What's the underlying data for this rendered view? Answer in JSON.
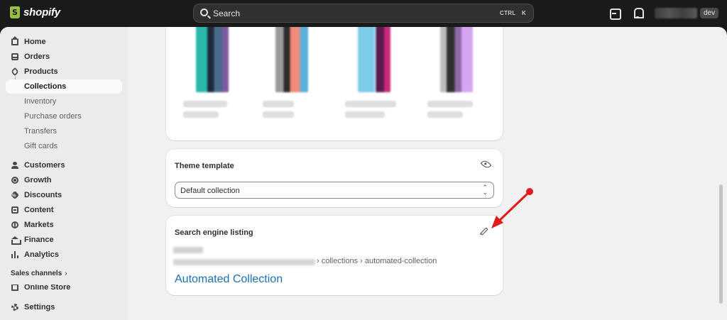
{
  "topbar": {
    "logo_text": "shopify",
    "search_placeholder": "Search",
    "shortcut_ctrl": "CTRL",
    "shortcut_k": "K",
    "store_badge": "dev"
  },
  "sidebar": {
    "items": [
      {
        "label": "Home",
        "icon": "home-icon"
      },
      {
        "label": "Orders",
        "icon": "orders-icon"
      },
      {
        "label": "Products",
        "icon": "tag-icon"
      },
      {
        "label": "Collections",
        "icon": "",
        "active": true
      },
      {
        "label": "Inventory",
        "icon": ""
      },
      {
        "label": "Purchase orders",
        "icon": ""
      },
      {
        "label": "Transfers",
        "icon": ""
      },
      {
        "label": "Gift cards",
        "icon": ""
      },
      {
        "label": "Customers",
        "icon": "person-icon"
      },
      {
        "label": "Growth",
        "icon": "growth-icon"
      },
      {
        "label": "Discounts",
        "icon": "discount-icon"
      },
      {
        "label": "Content",
        "icon": "content-icon"
      },
      {
        "label": "Markets",
        "icon": "globe-icon"
      },
      {
        "label": "Finance",
        "icon": "bank-icon"
      },
      {
        "label": "Analytics",
        "icon": "bar-chart-icon"
      }
    ],
    "sales_channels_label": "Sales channels",
    "sales_channels_chevron": "›",
    "online_store_label": "Online Store",
    "settings_label": "Settings"
  },
  "theme_card": {
    "title": "Theme template",
    "select_value": "Default collection",
    "select_chevron": "⌃⌄"
  },
  "seo_card": {
    "title": "Search engine listing",
    "url_tail": "› collections › automated-collection",
    "page_title": "Automated Collection"
  },
  "colors": {
    "accent_link": "#1a6fb5",
    "annotation_arrow": "#e01b1b",
    "topbar": "#1a1a1a"
  }
}
